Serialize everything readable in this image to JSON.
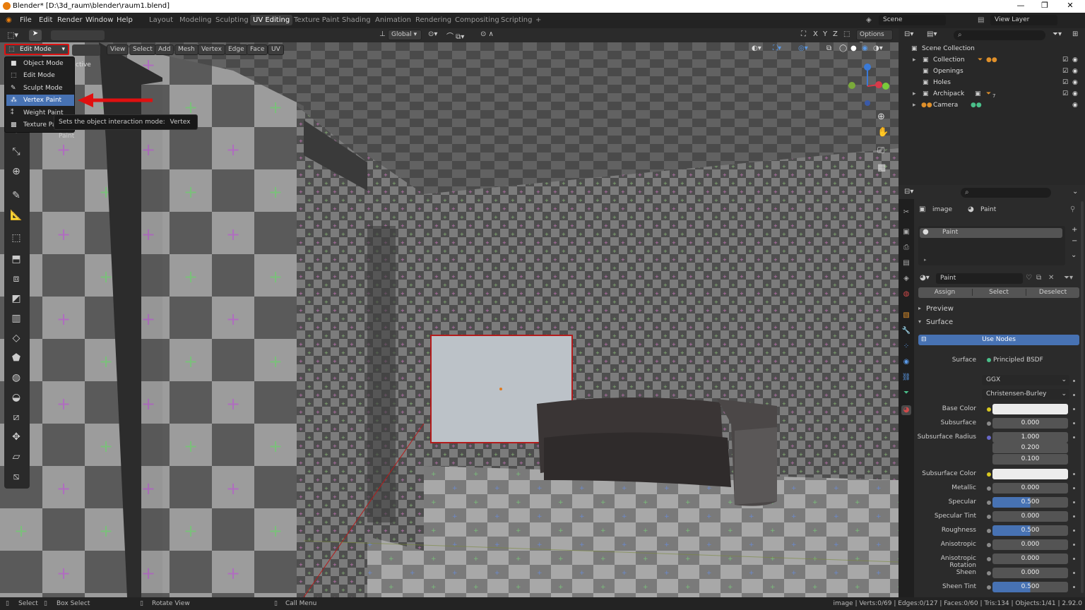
{
  "title_bar": {
    "title": "Blender* [D:\\3d_raum\\blender\\raum1.blend]",
    "min": "—",
    "restore": "❐",
    "close": "✕"
  },
  "menu": [
    "File",
    "Edit",
    "Render",
    "Window",
    "Help"
  ],
  "workspaces": [
    "Layout",
    "Modeling",
    "Sculpting",
    "UV Editing",
    "Texture Paint",
    "Shading",
    "Animation",
    "Rendering",
    "Compositing",
    "Scripting",
    "+"
  ],
  "active_workspace": "UV Editing",
  "scene": "Scene",
  "view_layer": "View Layer",
  "viewport_header": {
    "mode": "Edit Mode",
    "menus": [
      "View",
      "Select",
      "Add",
      "Mesh",
      "Vertex",
      "Edge",
      "Face",
      "UV"
    ],
    "transform": "Global",
    "options": "Options",
    "x": "X",
    "y": "Y",
    "z": "Z"
  },
  "mode_menu": {
    "items": [
      "Object Mode",
      "Edit Mode",
      "Sculpt Mode",
      "Vertex Paint",
      "Weight Paint",
      "Texture Pa"
    ],
    "selected": "Vertex Paint",
    "behind_text": "ctive"
  },
  "tooltip": {
    "text": "Sets the object interaction mode:",
    "value": "Vertex Paint"
  },
  "outliner": {
    "root": "Scene Collection",
    "items": [
      {
        "name": "Collection",
        "badge": "▾"
      },
      {
        "name": "Openings",
        "badge": ""
      },
      {
        "name": "Holes",
        "badge": ""
      },
      {
        "name": "Archipack",
        "badge": "7"
      },
      {
        "name": "Camera",
        "badge": ""
      }
    ]
  },
  "properties": {
    "object": "image",
    "material": "Paint",
    "slot": "Paint",
    "material_name": "Paint",
    "assign": "Assign",
    "select": "Select",
    "deselect": "Deselect",
    "preview": "Preview",
    "surface_section": "Surface",
    "use_nodes": "Use Nodes",
    "surface_label": "Surface",
    "surface_value": "Principled BSDF",
    "distribution": "GGX",
    "subsurface_method": "Christensen-Burley",
    "rows": [
      {
        "label": "Base Color",
        "value": "",
        "kind": "white",
        "dot": "#d8c820"
      },
      {
        "label": "Subsurface",
        "value": "0.000",
        "kind": "num",
        "dot": "#8a8a8a"
      },
      {
        "label": "Subsurface Radius",
        "value": "1.000",
        "kind": "num",
        "dot": "#6868c8"
      },
      {
        "label": "",
        "value": "0.200",
        "kind": "num",
        "dot": ""
      },
      {
        "label": "",
        "value": "0.100",
        "kind": "num",
        "dot": ""
      },
      {
        "label": "Subsurface Color",
        "value": "",
        "kind": "white",
        "dot": "#d8c820"
      },
      {
        "label": "Metallic",
        "value": "0.000",
        "kind": "num",
        "dot": "#8a8a8a"
      },
      {
        "label": "Specular",
        "value": "0.500",
        "kind": "blue",
        "dot": "#8a8a8a"
      },
      {
        "label": "Specular Tint",
        "value": "0.000",
        "kind": "num",
        "dot": "#8a8a8a"
      },
      {
        "label": "Roughness",
        "value": "0.500",
        "kind": "blue",
        "dot": "#8a8a8a"
      },
      {
        "label": "Anisotropic",
        "value": "0.000",
        "kind": "num",
        "dot": "#8a8a8a"
      },
      {
        "label": "Anisotropic Rotation",
        "value": "0.000",
        "kind": "num",
        "dot": "#8a8a8a"
      },
      {
        "label": "Sheen",
        "value": "0.000",
        "kind": "num",
        "dot": "#8a8a8a"
      },
      {
        "label": "Sheen Tint",
        "value": "0.500",
        "kind": "blue",
        "dot": "#8a8a8a"
      }
    ]
  },
  "status_bar": {
    "select": "Select",
    "box_select": "Box Select",
    "rotate_view": "Rotate View",
    "call_menu": "Call Menu",
    "stats": "image | Verts:0/69 | Edges:0/127 | Faces:0/60 | Tris:134 | Objects:1/41 | 2.92.0"
  },
  "colors": {
    "accent": "#4772b3",
    "highlight_red": "#dd1111"
  }
}
